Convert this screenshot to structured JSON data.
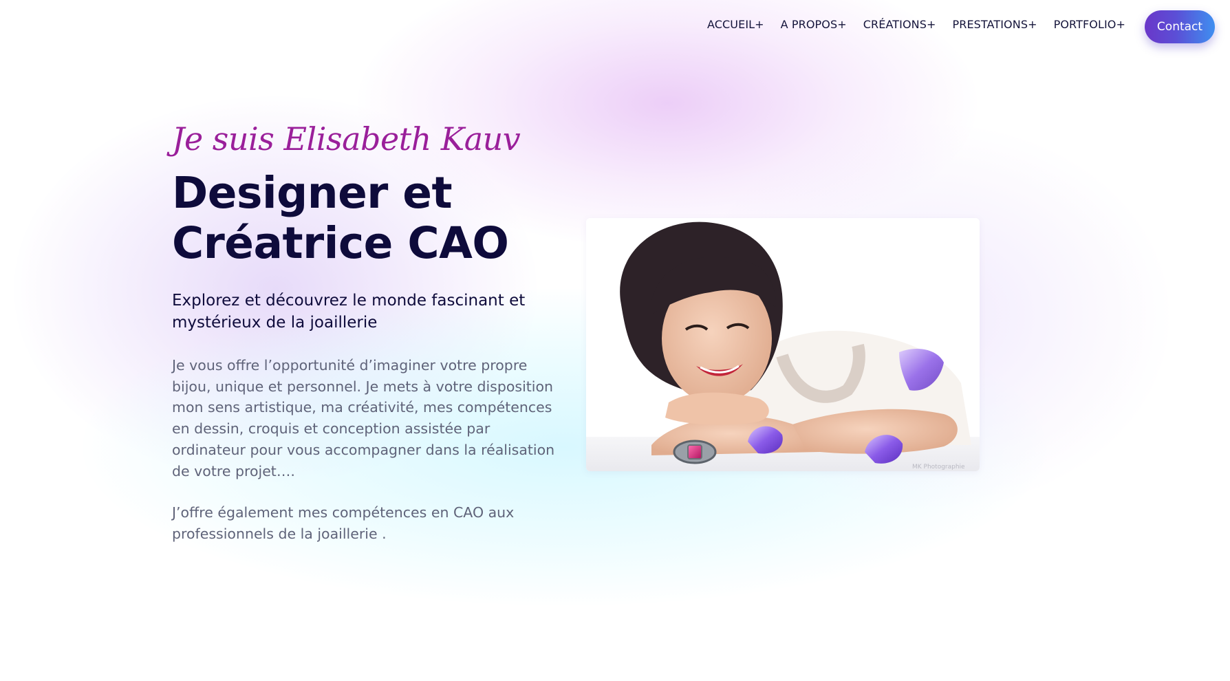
{
  "nav": {
    "items": [
      {
        "label": "ACCUEIL+"
      },
      {
        "label": "A PROPOS+"
      },
      {
        "label": "CRÉATIONS+"
      },
      {
        "label": "PRESTATIONS+"
      },
      {
        "label": "PORTFOLIO+"
      }
    ],
    "contact_label": "Contact"
  },
  "hero": {
    "script_name": "Je suis Elisabeth Kauv",
    "title_line1": "Designer et",
    "title_line2": "Créatrice CAO",
    "subtitle": "Explorez et découvrez le monde fascinant et mystérieux de la joaillerie",
    "paragraph1": "Je vous offre l’opportunité d’imaginer votre propre bijou, unique et personnel. Je mets à votre disposition mon sens artistique, ma créativité, mes compétences en dessin, croquis et conception assistée par ordinateur pour vous accompagner dans la réalisation de votre projet….",
    "paragraph2": "J’offre également mes compétences en CAO aux professionnels de la joaillerie ."
  },
  "photo": {
    "watermark": "MK Photographie"
  },
  "colors": {
    "script_accent": "#9a1f9a",
    "heading": "#0e0b3b",
    "body_text": "#5f6379",
    "button_start": "#6a37c9",
    "button_end": "#3f8ff0"
  }
}
